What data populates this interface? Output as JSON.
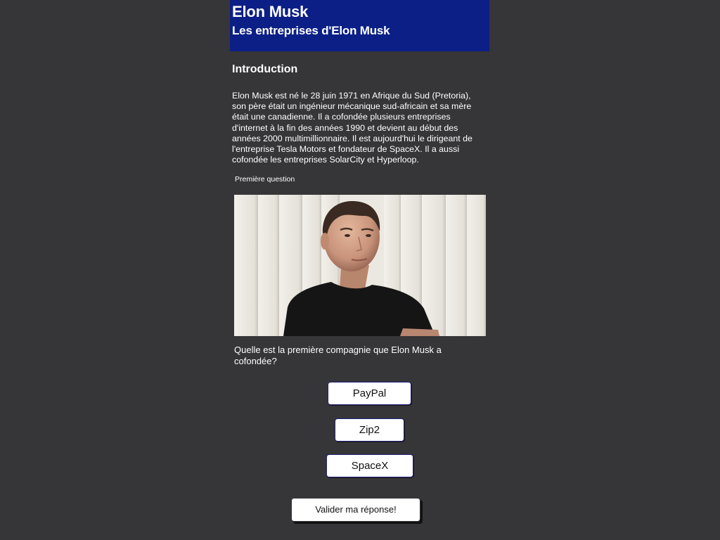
{
  "header": {
    "title": "Elon Musk",
    "subtitle": "Les entreprises d'Elon Musk"
  },
  "intro": {
    "heading": "Introduction",
    "text": "Elon Musk est né le 28 juin 1971 en Afrique du Sud (Pretoria), son père était un ingénieur mécanique sud-africain et sa mère était une canadienne. Il a cofondée plusieurs entreprises d'internet à la fin des années 1990 et devient au début des années 2000 multimillionnaire. Il est aujourd'hui le dirigeant de l'entreprise Tesla Motors et fondateur de SpaceX. Il a aussi cofondée les entreprises SolarCity et Hyperloop."
  },
  "quiz": {
    "label": "Première question",
    "question": "Quelle est la première compagnie que Elon Musk a cofondée?",
    "answers": [
      {
        "label": "PayPal"
      },
      {
        "label": "Zip2"
      },
      {
        "label": "SpaceX"
      }
    ],
    "submit_label": "Valider ma réponse!"
  },
  "colors": {
    "background": "#363538",
    "header": "#0b1f86",
    "text": "#ffffff",
    "button_bg": "#ffffff"
  }
}
